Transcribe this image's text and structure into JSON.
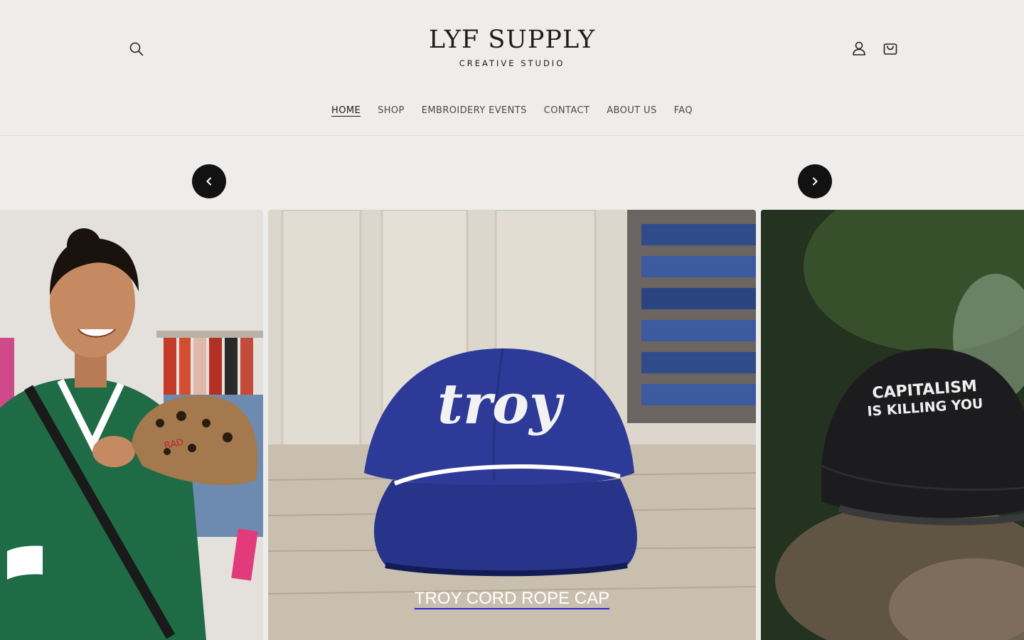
{
  "brand": {
    "name": "LYF SUPPLY",
    "tagline": "CREATIVE STUDIO"
  },
  "header": {
    "icons": [
      "search-icon",
      "account-icon",
      "cart-icon"
    ]
  },
  "nav": {
    "items": [
      {
        "label": "HOME",
        "active": true
      },
      {
        "label": "SHOP"
      },
      {
        "label": "EMBROIDERY EVENTS"
      },
      {
        "label": "CONTACT"
      },
      {
        "label": "ABOUT US"
      },
      {
        "label": "FAQ"
      }
    ]
  },
  "carousel": {
    "prev_icon": "chevron-left-icon",
    "next_icon": "chevron-right-icon",
    "slides": [
      {
        "image": "woman-holding-leopard-cap",
        "cap_text": "RAD"
      },
      {
        "image": "blue-troy-cap",
        "cap_text": "troy",
        "caption": "TROY CORD ROPE CAP"
      },
      {
        "image": "black-capitalism-cap",
        "cap_text_line1": "CAPITALISM",
        "cap_text_line2": "IS KILLING YOU"
      }
    ]
  },
  "colors": {
    "background": "#eeedeb",
    "arrow_button": "#121212",
    "troy_cap": "#2d3a98",
    "caption_underline": "#2a2ad8"
  }
}
